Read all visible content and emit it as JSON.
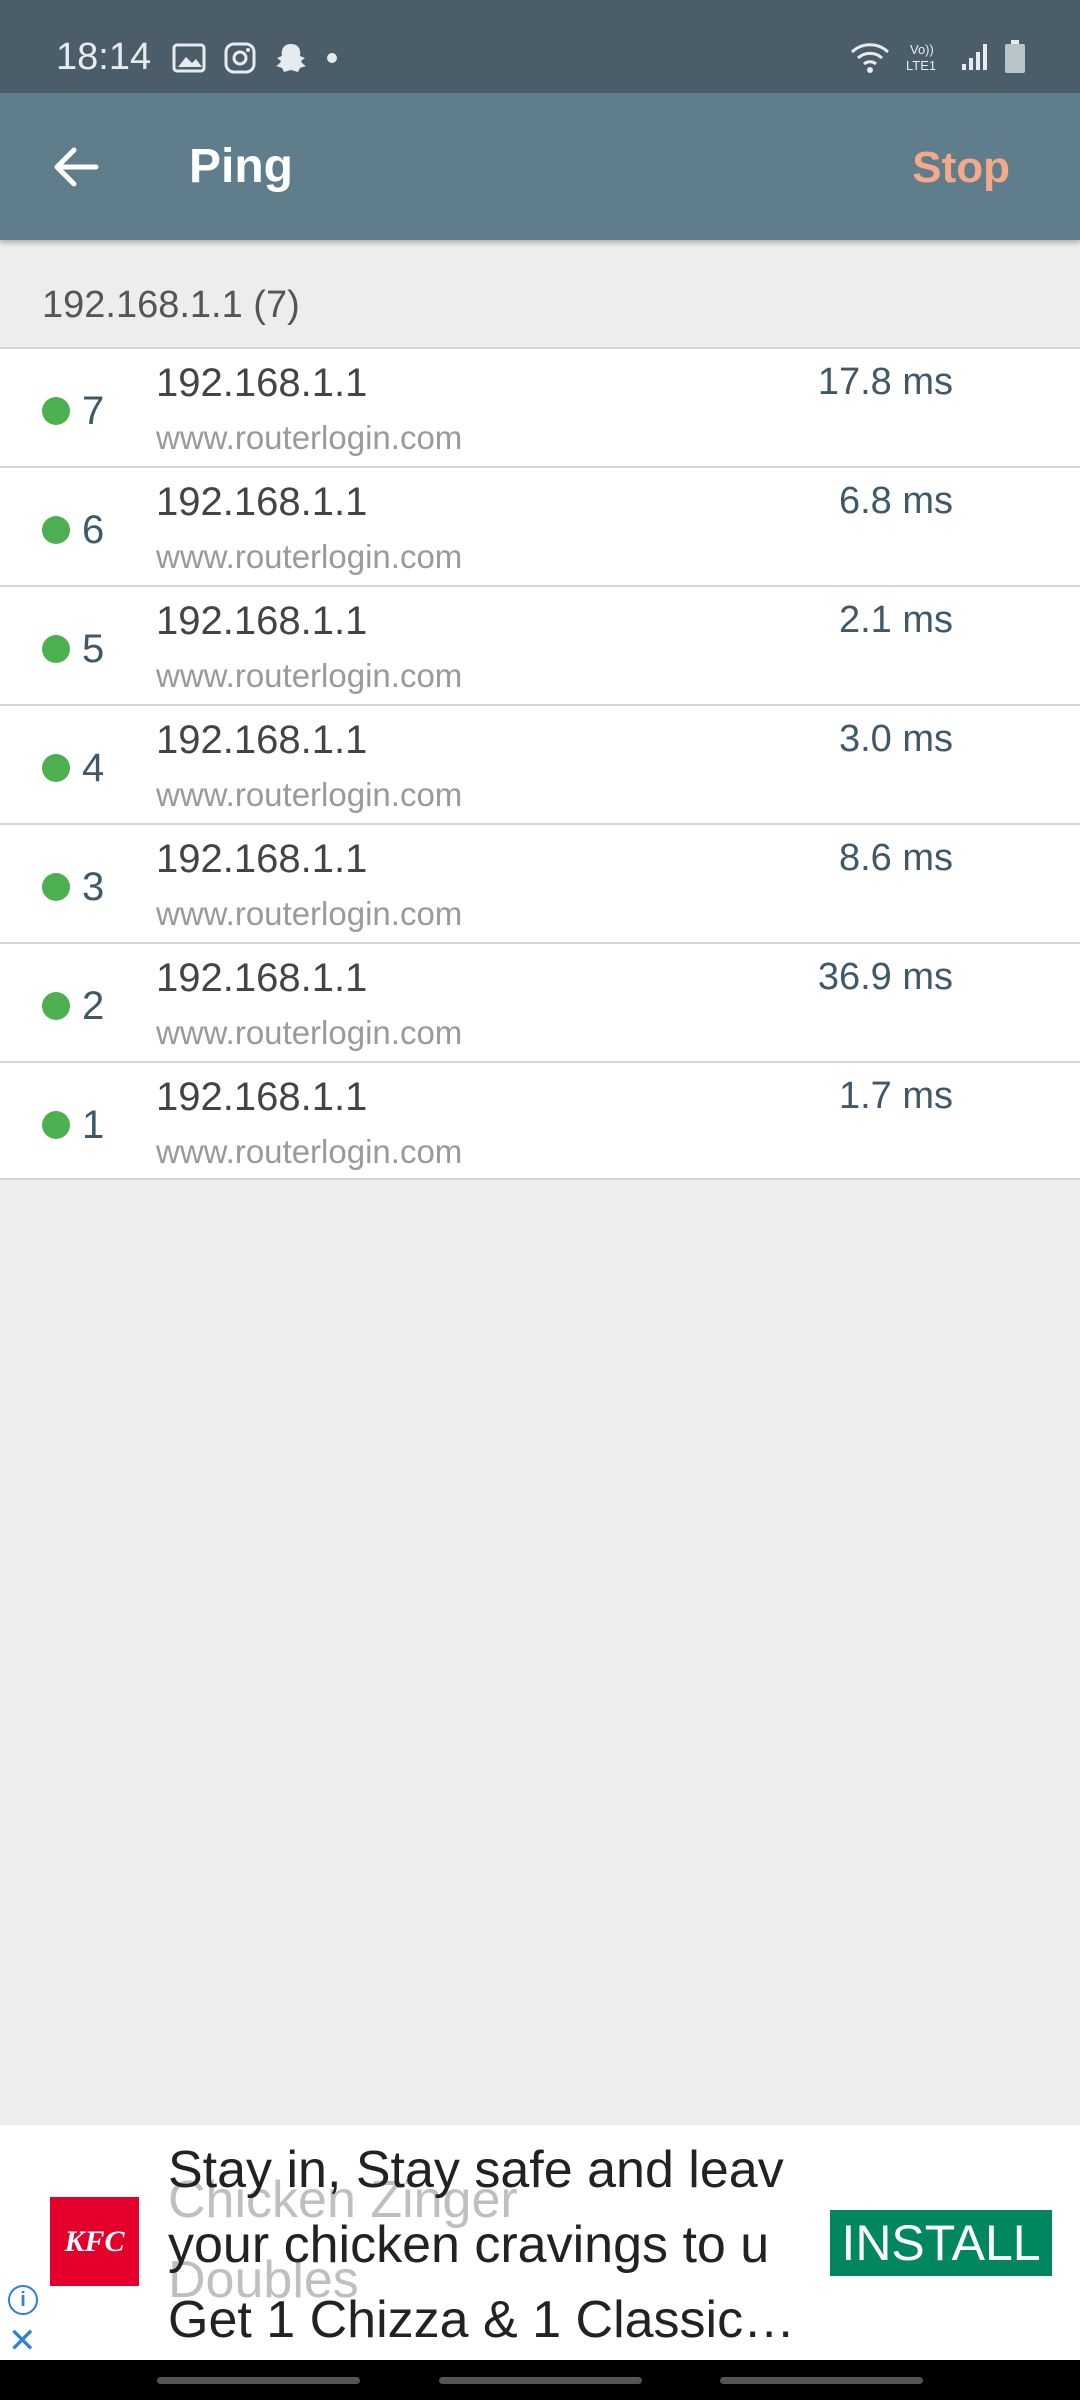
{
  "status_bar": {
    "time": "18:14",
    "icons_left": [
      "gallery-icon",
      "instagram-icon",
      "snapchat-icon",
      "dot-icon"
    ],
    "icons_right": [
      "wifi-icon",
      "volte-icon",
      "signal-icon",
      "battery-icon"
    ],
    "volte_label": "Vo)) LTE1"
  },
  "app_bar": {
    "title": "Ping",
    "action": "Stop",
    "back_icon": "arrow-left-icon"
  },
  "colors": {
    "app_bar": "#607d8b",
    "status_bar": "#4a5d69",
    "status_ok": "#4caf50",
    "accent": "#f4a98a"
  },
  "group": {
    "header": "192.168.1.1 (7)"
  },
  "results": [
    {
      "seq": "7",
      "ip": "192.168.1.1",
      "host": "www.routerlogin.com",
      "time": "17.8 ms"
    },
    {
      "seq": "6",
      "ip": "192.168.1.1",
      "host": "www.routerlogin.com",
      "time": "6.8 ms"
    },
    {
      "seq": "5",
      "ip": "192.168.1.1",
      "host": "www.routerlogin.com",
      "time": "2.1 ms"
    },
    {
      "seq": "4",
      "ip": "192.168.1.1",
      "host": "www.routerlogin.com",
      "time": "3.0 ms"
    },
    {
      "seq": "3",
      "ip": "192.168.1.1",
      "host": "www.routerlogin.com",
      "time": "8.6 ms"
    },
    {
      "seq": "2",
      "ip": "192.168.1.1",
      "host": "www.routerlogin.com",
      "time": "36.9 ms"
    },
    {
      "seq": "1",
      "ip": "192.168.1.1",
      "host": "www.routerlogin.com",
      "time": "1.7 ms"
    }
  ],
  "ad": {
    "brand": "KFC",
    "line1": "Stay in, Stay safe and leav",
    "line2": "your chicken cravings to u",
    "line3": "Get 1 Chizza & 1 Classic…",
    "ghost1": "Chicken Zinger",
    "ghost2": "Doubles",
    "cta": "INSTALL"
  }
}
